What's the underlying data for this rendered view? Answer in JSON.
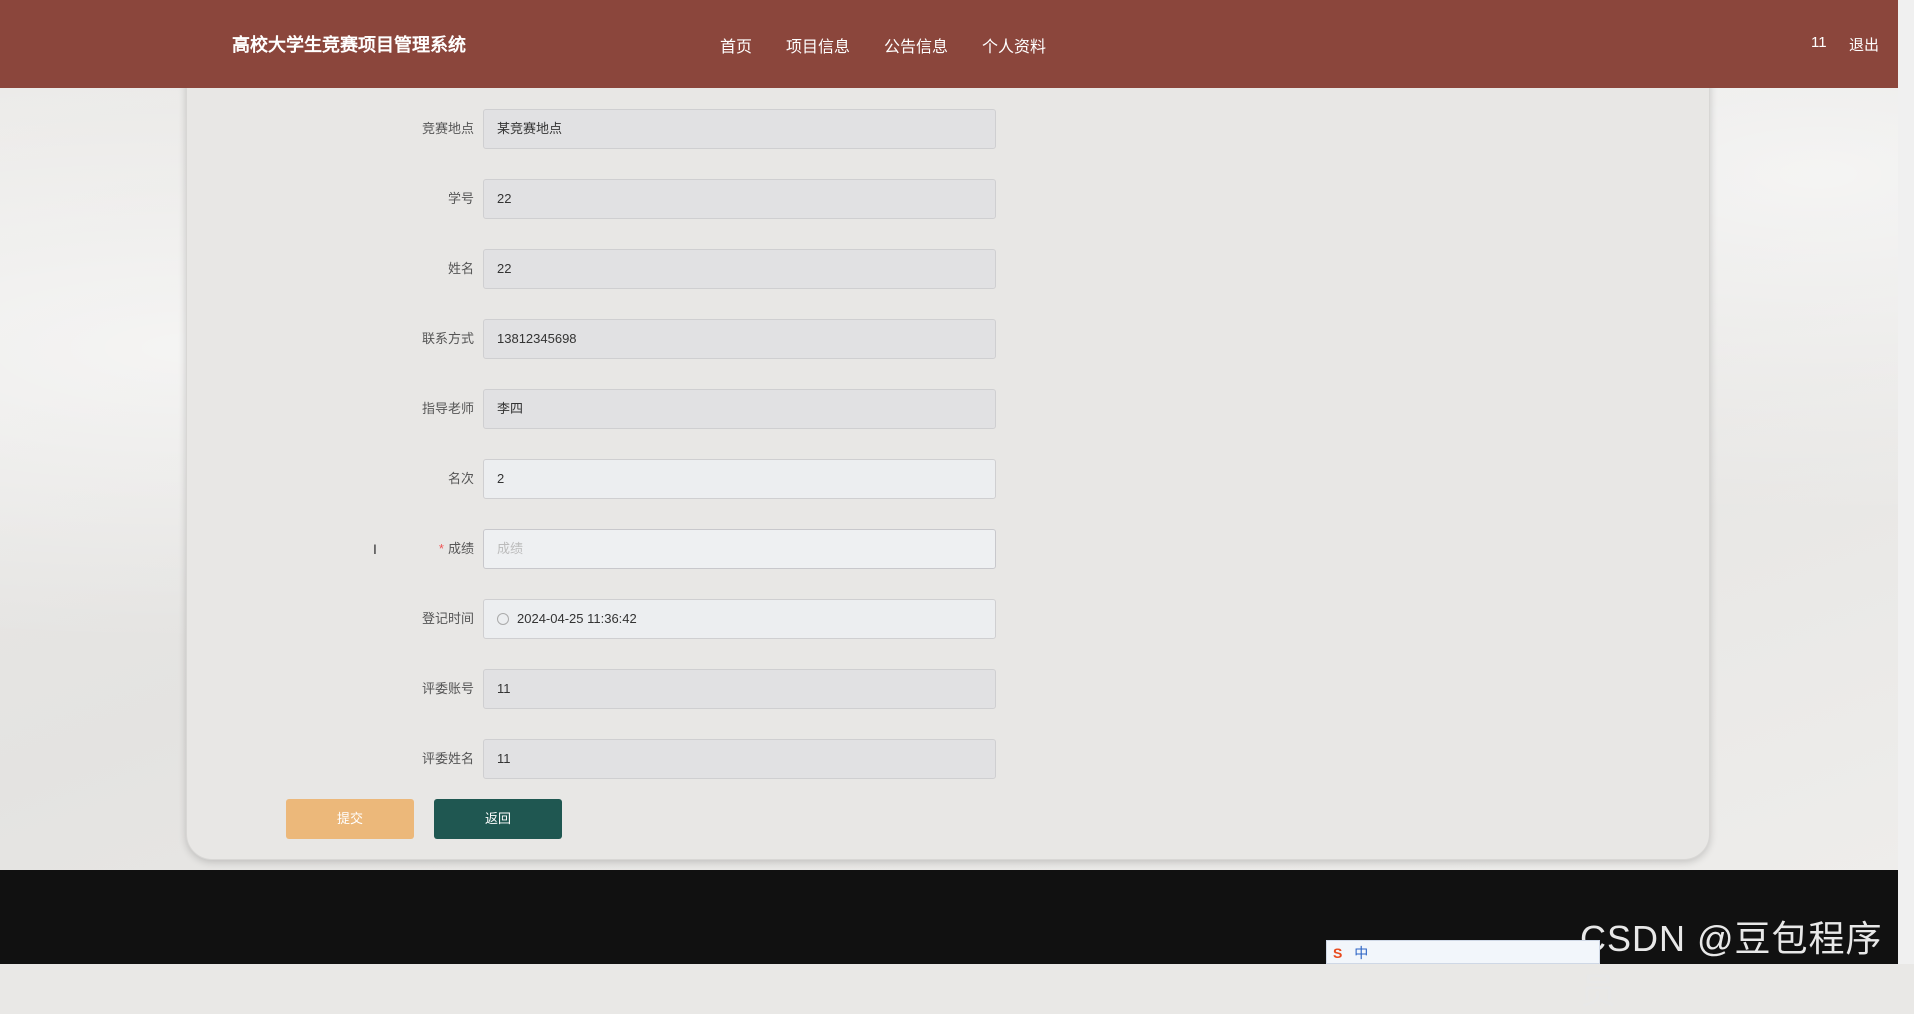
{
  "app": {
    "title": "高校大学生竞赛项目管理系统"
  },
  "nav": {
    "items": [
      "首页",
      "项目信息",
      "公告信息",
      "个人资料"
    ]
  },
  "user": {
    "name": "11",
    "logout": "退出"
  },
  "form": {
    "fields": [
      {
        "label": "竞赛地点",
        "value": "某竞赛地点"
      },
      {
        "label": "学号",
        "value": "22"
      },
      {
        "label": "姓名",
        "value": "22"
      },
      {
        "label": "联系方式",
        "value": "13812345698"
      },
      {
        "label": "指导老师",
        "value": "李四"
      },
      {
        "label": "名次",
        "value": "2"
      },
      {
        "label": "成绩",
        "value": "",
        "placeholder": "成绩",
        "required": true
      },
      {
        "label": "登记时间",
        "value": "2024-04-25 11:36:42"
      },
      {
        "label": "评委账号",
        "value": "11"
      },
      {
        "label": "评委姓名",
        "value": "11"
      }
    ],
    "required_mark": "*",
    "submit_label": "提交",
    "back_label": "返回"
  },
  "watermark": "CSDN @豆包程序员",
  "ime": {
    "logo": "S",
    "mode": "中"
  },
  "icons": [
    "clock-icon",
    "text-cursor-icon",
    "ime-logo-icon"
  ]
}
